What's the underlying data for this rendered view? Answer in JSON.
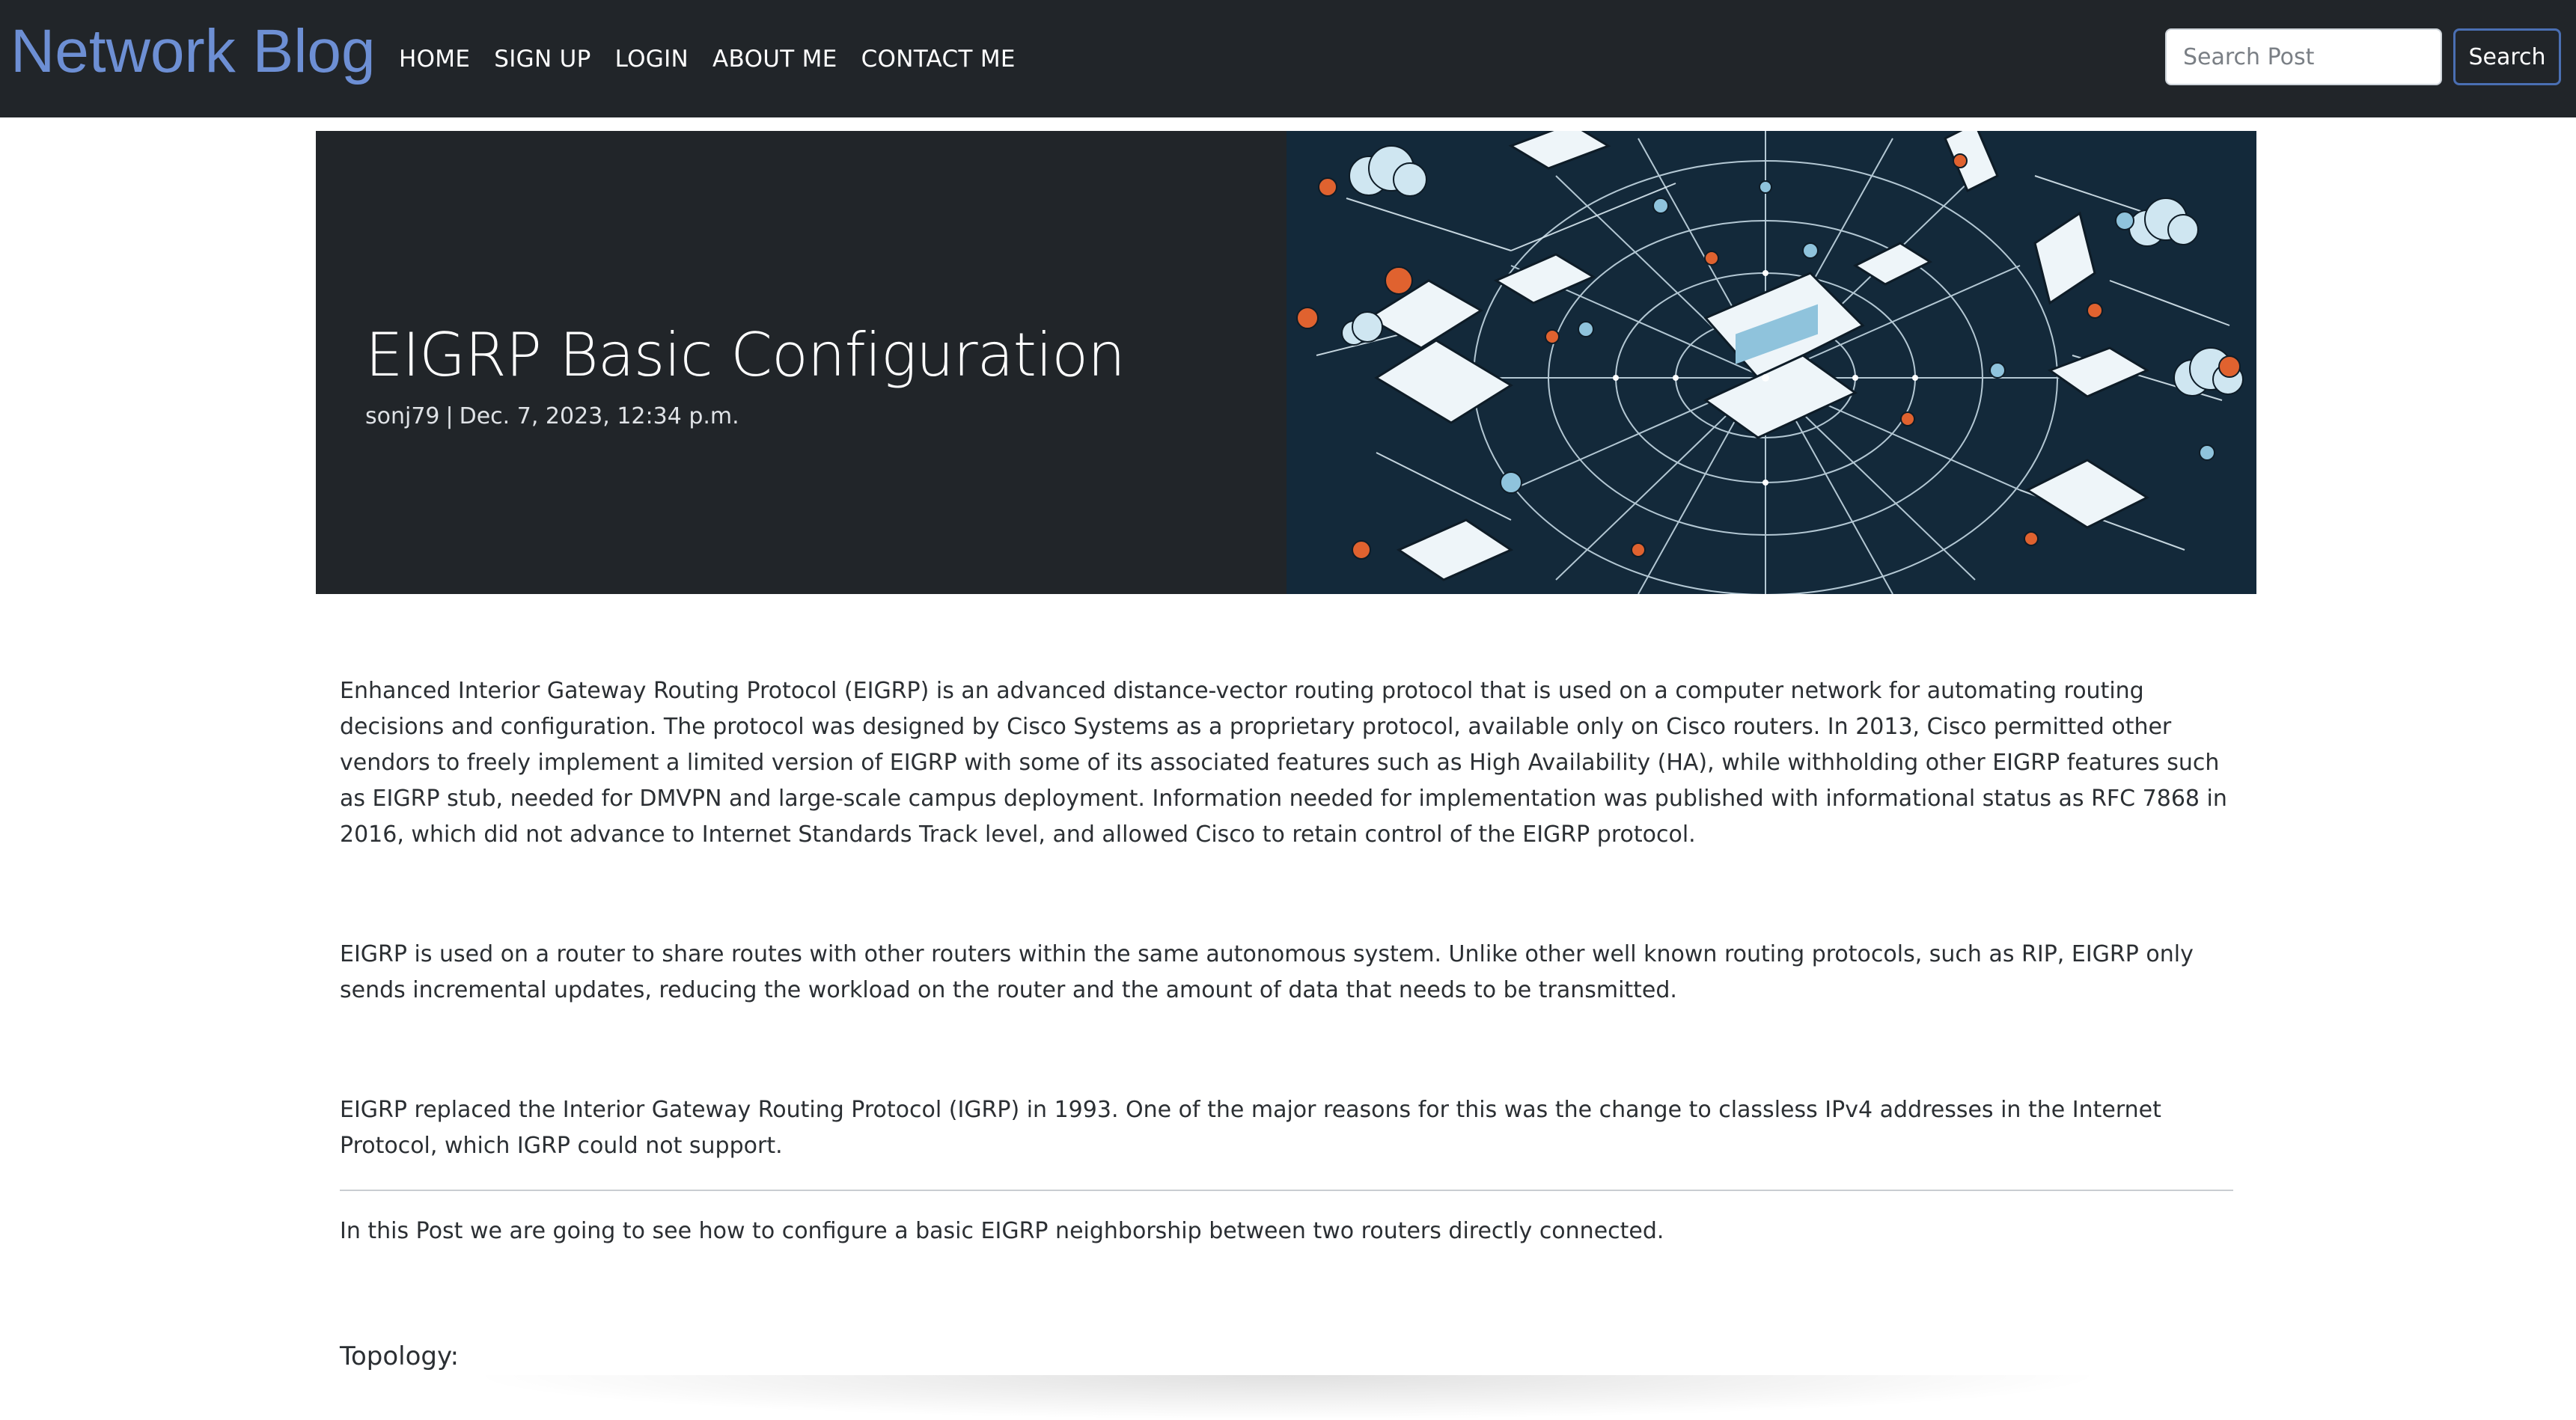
{
  "navbar": {
    "brand": "Network Blog",
    "links": [
      "HOME",
      "SIGN UP",
      "LOGIN",
      "ABOUT ME",
      "CONTACT ME"
    ],
    "search_placeholder": "Search Post",
    "search_button": "Search"
  },
  "post": {
    "title": "EIGRP Basic Configuration",
    "author": "sonj79",
    "separator": "|",
    "date": "Dec. 7, 2023, 12:34 p.m.",
    "paragraphs": [
      "Enhanced Interior Gateway Routing Protocol (EIGRP) is an advanced distance-vector routing protocol that is used on a computer network for automating routing decisions and configuration. The protocol was designed by Cisco Systems as a proprietary protocol, available only on Cisco routers. In 2013, Cisco permitted other vendors to freely implement a limited version of EIGRP with some of its associated features such as High Availability (HA), while withholding other EIGRP features such as EIGRP stub, needed for DMVPN and large-scale campus deployment. Information needed for implementation was published with informational status as RFC 7868 in 2016, which did not advance to Internet Standards Track level, and allowed Cisco to retain control of the EIGRP protocol.",
      "EIGRP is used on a router to share routes with other routers within the same autonomous system. Unlike other well known routing protocols, such as RIP, EIGRP only sends incremental updates, reducing the workload on the router and the amount of data that needs to be transmitted.",
      "EIGRP replaced the Interior Gateway Routing Protocol (IGRP) in 1993. One of the major reasons for this was the change to classless IPv4 addresses in the Internet Protocol, which IGRP could not support.",
      "In this Post we are going to see how to configure a basic EIGRP neighborship between two routers directly connected."
    ],
    "topology_label": "Topology:"
  },
  "colors": {
    "navbar_bg": "#212529",
    "brand": "#6d8fd4",
    "hero_bg": "#212529",
    "illustration_bg": "#13293a",
    "accent_orange": "#e0622f",
    "accent_blue": "#8fc3dc"
  },
  "icons": [
    "laptop-icon",
    "monitor-icon",
    "router-icon",
    "cloud-icon",
    "tablet-icon",
    "server-icon"
  ]
}
